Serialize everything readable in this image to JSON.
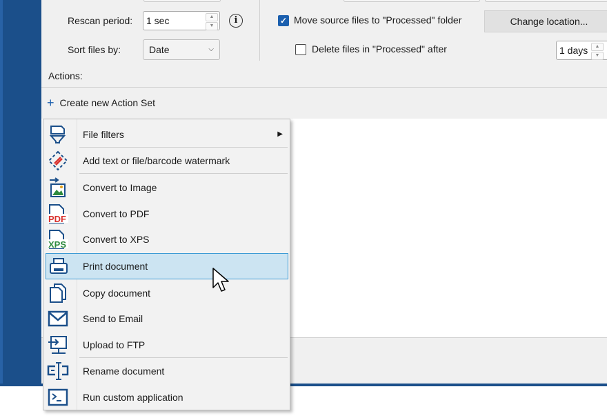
{
  "settings": {
    "rescan_label": "Rescan period:",
    "rescan_value": "1 sec",
    "sort_label": "Sort files by:",
    "sort_value": "Date",
    "move_label": "Move source files to \"Processed\" folder",
    "move_checked": true,
    "delete_label": "Delete files in \"Processed\" after",
    "delete_checked": false,
    "change_location": "Change location...",
    "days_value": "1 days",
    "actions_label": "Actions:"
  },
  "create_action_set": "Create new Action Set",
  "menu": {
    "items": [
      {
        "label": "File filters",
        "icon": "funnel-icon",
        "submenu": true
      },
      {
        "label": "Add text or file/barcode watermark",
        "icon": "watermark-icon"
      },
      {
        "label": "Convert to Image",
        "icon": "image-convert-icon"
      },
      {
        "label": "Convert to PDF",
        "icon": "pdf-icon"
      },
      {
        "label": "Convert to XPS",
        "icon": "xps-icon"
      },
      {
        "label": "Print document",
        "icon": "printer-icon",
        "highlighted": true
      },
      {
        "label": "Copy document",
        "icon": "copy-icon"
      },
      {
        "label": "Send to Email",
        "icon": "mail-icon"
      },
      {
        "label": "Upload to FTP",
        "icon": "ftp-upload-icon"
      },
      {
        "label": "Rename document",
        "icon": "rename-icon"
      },
      {
        "label": "Run custom application",
        "icon": "terminal-icon"
      }
    ],
    "icon_glyphs": {
      "pdf": "PDF",
      "xps": "XPS"
    }
  },
  "colors": {
    "accent": "#1b5fae",
    "sidebar": "#1b4f8a",
    "highlight": "#cce4f2",
    "highlight_border": "#3d9bd5",
    "pdf_red": "#d9302c",
    "xps_green": "#2e8b3e"
  }
}
